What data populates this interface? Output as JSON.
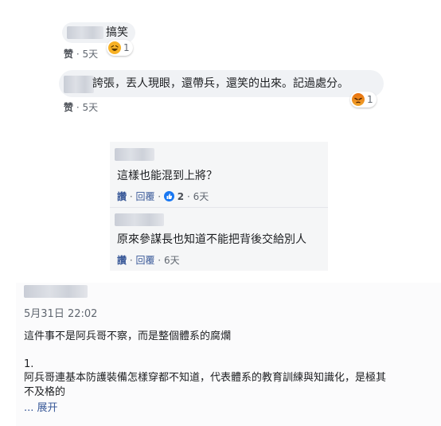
{
  "comments": [
    {
      "text": "搞笑",
      "meta_action": "赞",
      "meta_time": "5天",
      "reaction": "haha-icon",
      "reaction_count": "1"
    },
    {
      "text": "誇張，丟人現眼，還帶兵，還笑的出來。記過處分。",
      "meta_action": "赞",
      "meta_time": "5天",
      "reaction": "angry-icon",
      "reaction_count": "1"
    }
  ],
  "replies": [
    {
      "text": "這樣也能混到上將？",
      "like": "讚",
      "reply": "回覆",
      "like_count": "2",
      "time": "6天"
    },
    {
      "text": "原來參謀長也知道不能把背後交給別人",
      "like": "讚",
      "reply": "回覆",
      "time": "6天"
    }
  ],
  "post": {
    "date": "5月31日 22:02",
    "paragraph1": "這件事不是阿兵哥不察，而是整個體系的腐爛",
    "list_number": "1.",
    "paragraph2_line1": "阿兵哥連基本防護裝備怎樣穿都不知道，代表體系的教育訓練與知識化，是極其",
    "paragraph2_line2": "不及格的",
    "expand": "... 展开"
  },
  "colors": {
    "link": "#385898",
    "meta": "#606770",
    "bubble": "#f0f2f5",
    "like_blue": "#1877f2"
  }
}
